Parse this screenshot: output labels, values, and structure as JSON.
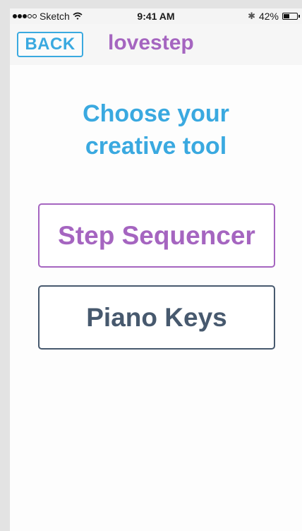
{
  "status_bar": {
    "carrier": "Sketch",
    "time": "9:41 AM",
    "battery_text": "42%",
    "battery_level": 0.42
  },
  "nav": {
    "back_label": "BACK",
    "title": "lovestep"
  },
  "main": {
    "heading_line1": "Choose your",
    "heading_line2": "creative tool",
    "options": [
      {
        "label": "Step Sequencer"
      },
      {
        "label": "Piano Keys"
      }
    ]
  },
  "colors": {
    "accent_blue": "#3aa9e0",
    "accent_purple": "#a565c0",
    "slate": "#47596e"
  }
}
